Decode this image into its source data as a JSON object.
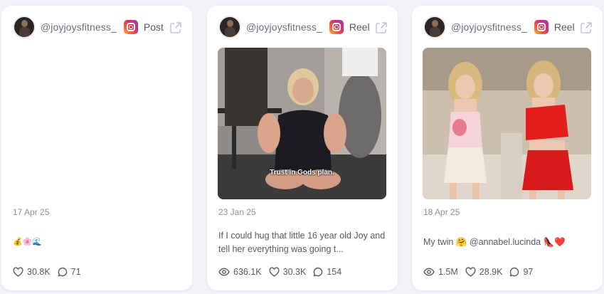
{
  "cards": [
    {
      "handle": "@joyjoysfitness_",
      "type": "Post",
      "date": "17 Apr 25",
      "caption": "💰🌸🌊",
      "stats": {
        "likes": "30.8K",
        "comments": "71"
      }
    },
    {
      "handle": "@joyjoysfitness_",
      "type": "Reel",
      "overlay_text": "Trust in Gods plan.",
      "date": "23 Jan 25",
      "caption": "If I could hug that little 16 year old Joy and tell her everything was going t...",
      "stats": {
        "views": "636.1K",
        "likes": "30.3K",
        "comments": "154"
      }
    },
    {
      "handle": "@joyjoysfitness_",
      "type": "Reel",
      "date": "18 Apr 25",
      "caption": "My twin 🤗 @annabel.lucinda 👠❤️",
      "stats": {
        "views": "1.5M",
        "likes": "28.9K",
        "comments": "97"
      }
    }
  ],
  "colors": {
    "page_bg": "#f3f4f8",
    "card_bg": "#ffffff",
    "text": "#555a66",
    "muted": "#8b8f9a"
  },
  "icons": [
    "avatar",
    "instagram-icon",
    "external-link-icon",
    "eye-icon",
    "heart-icon",
    "comment-icon"
  ]
}
